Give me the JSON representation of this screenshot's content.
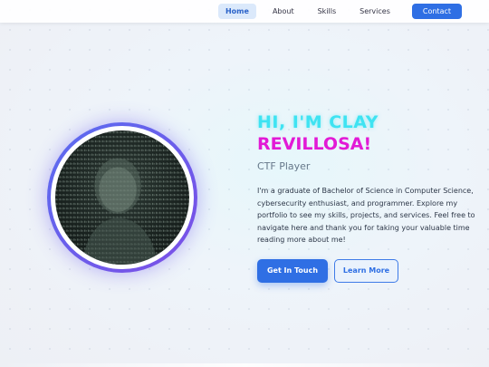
{
  "nav": {
    "items": [
      {
        "label": "Home",
        "active": true
      },
      {
        "label": "About",
        "active": false
      },
      {
        "label": "Skills",
        "active": false
      },
      {
        "label": "Services",
        "active": false
      }
    ],
    "contact_label": "Contact"
  },
  "hero": {
    "name_line_1": "HI, I'M CLAY",
    "name_line_2": "REVILLOSA!",
    "subtitle": "CTF Player",
    "bio": "I'm a graduate of Bachelor of Science in Computer Science, cybersecurity enthusiast, and programmer. Explore my portfolio to see my skills, projects, and services. Feel free to navigate here and thank you for taking your valuable time reading more about me!",
    "primary_button": "Get In Touch",
    "secondary_button": "Learn More"
  },
  "colors": {
    "accent": "#2f6fe4",
    "name_cyan": "#3ee3f2",
    "name_magenta": "#e21ad6",
    "ring": "#5a6df0"
  },
  "icons": {
    "avatar": "ascii-portrait"
  }
}
